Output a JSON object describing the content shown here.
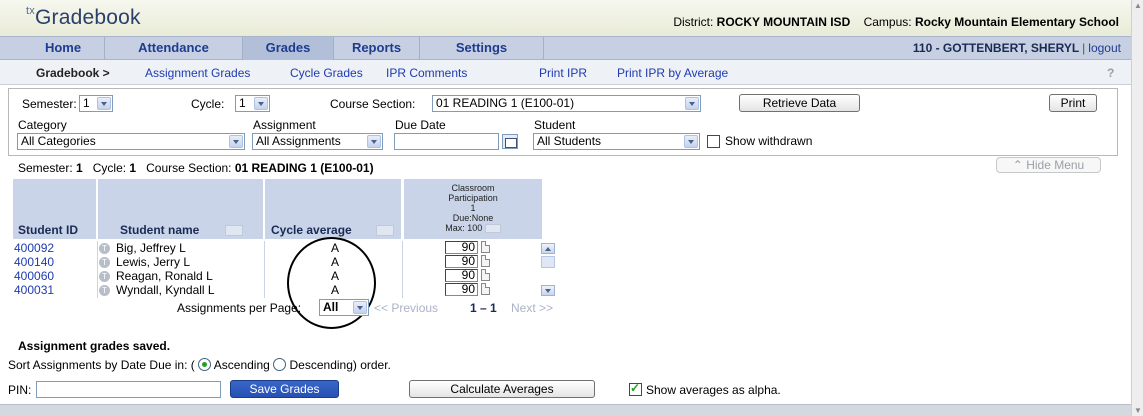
{
  "header": {
    "logo_prefix": "tx",
    "logo": "Gradebook",
    "district_label": "District:",
    "district": "ROCKY MOUNTAIN ISD",
    "campus_label": "Campus:",
    "campus": "Rocky Mountain Elementary School"
  },
  "nav": {
    "items": [
      "Home",
      "Attendance",
      "Grades",
      "Reports",
      "Settings"
    ],
    "active": "Grades",
    "user": "110 - GOTTENBERT, SHERYL",
    "logout": "logout"
  },
  "subnav": {
    "crumb": "Gradebook >",
    "links": [
      "Assignment Grades",
      "Cycle Grades",
      "IPR Comments",
      "Print IPR",
      "Print IPR by Average"
    ]
  },
  "filters": {
    "semester_label": "Semester:",
    "semester": "1",
    "cycle_label": "Cycle:",
    "cycle": "1",
    "course_label": "Course Section:",
    "course": "01 READING 1 (E100-01)",
    "retrieve": "Retrieve Data",
    "print": "Print",
    "category_label": "Category",
    "category": "All Categories",
    "assignment_label": "Assignment",
    "assignment": "All Assignments",
    "due_label": "Due Date",
    "due_value": "",
    "student_label": "Student",
    "student": "All Students",
    "withdrawn": "Show withdrawn"
  },
  "section": {
    "semester_label": "Semester:",
    "semester": "1",
    "cycle_label": "Cycle:",
    "cycle": "1",
    "course_label": "Course Section:",
    "course": "01 READING 1 (E100-01)",
    "hide_menu": "Hide Menu"
  },
  "table": {
    "headers": {
      "student_id": "Student ID",
      "student_name": "Student name",
      "cycle_average": "Cycle average"
    },
    "assignment": {
      "line1": "Classroom",
      "line2": "Participation",
      "line3": "1",
      "line4": "Due:None",
      "line5": "Max: 100"
    },
    "rows": [
      {
        "id": "400092",
        "name": "Big, Jeffrey L",
        "avg": "A",
        "grade": "90"
      },
      {
        "id": "400140",
        "name": "Lewis, Jerry L",
        "avg": "A",
        "grade": "90"
      },
      {
        "id": "400060",
        "name": "Reagan, Ronald L",
        "avg": "A",
        "grade": "90"
      },
      {
        "id": "400031",
        "name": "Wyndall, Kyndall L",
        "avg": "A",
        "grade": "90"
      }
    ],
    "t_badge": "T"
  },
  "paging": {
    "label": "Assignments per Page:",
    "per_page": "All",
    "prev": "<< Previous",
    "range": "1 – 1",
    "next": "Next >>"
  },
  "status": {
    "saved": "Assignment grades saved.",
    "sort_prefix": "Sort Assignments by Date Due in: (",
    "ascending": "Ascending",
    "descending": "Descending) order."
  },
  "footer": {
    "pin_label": "PIN:",
    "pin_value": "",
    "save": "Save Grades",
    "calculate": "Calculate Averages",
    "show_alpha": "Show averages as alpha."
  }
}
